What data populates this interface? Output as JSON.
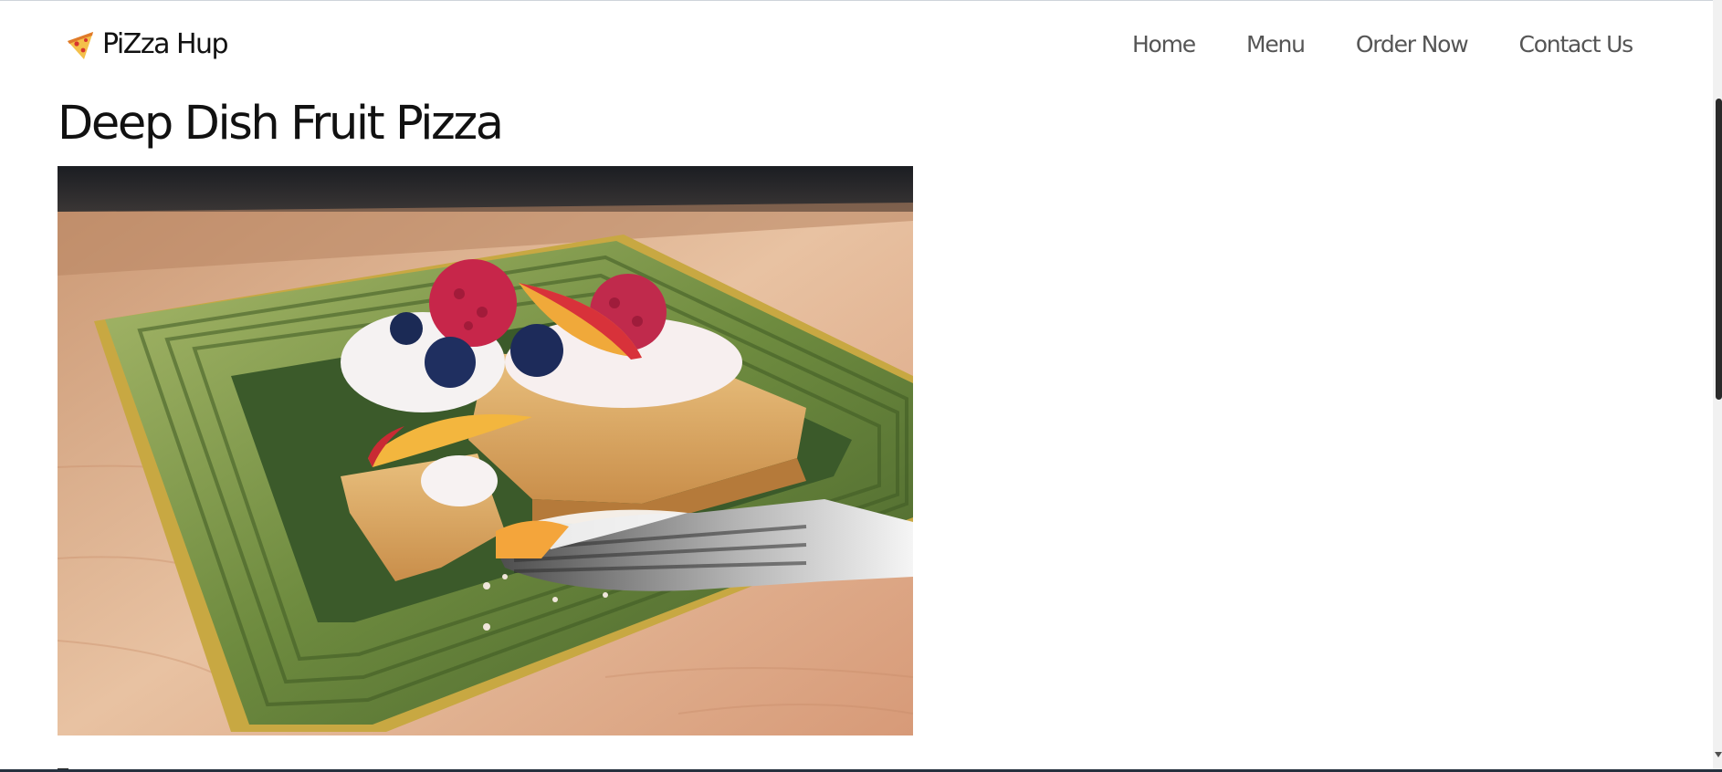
{
  "brand": {
    "name": "PiZza Hup",
    "icon": "pizza-slice-icon"
  },
  "nav": {
    "items": [
      {
        "label": "Home"
      },
      {
        "label": "Menu"
      },
      {
        "label": "Order Now"
      },
      {
        "label": "Contact Us"
      }
    ]
  },
  "main": {
    "title": "Deep Dish Fruit Pizza",
    "image": {
      "subject": "slice of deep dish fruit pizza with whipped cream, raspberries, blueberries and peach slices on a green square plate with a fork"
    }
  },
  "colors": {
    "text_dark": "#111111",
    "nav_text": "#555555",
    "plate_green": "#6b8a3c",
    "crust": "#d9a866",
    "scroll_thumb": "#2a2a2a"
  }
}
